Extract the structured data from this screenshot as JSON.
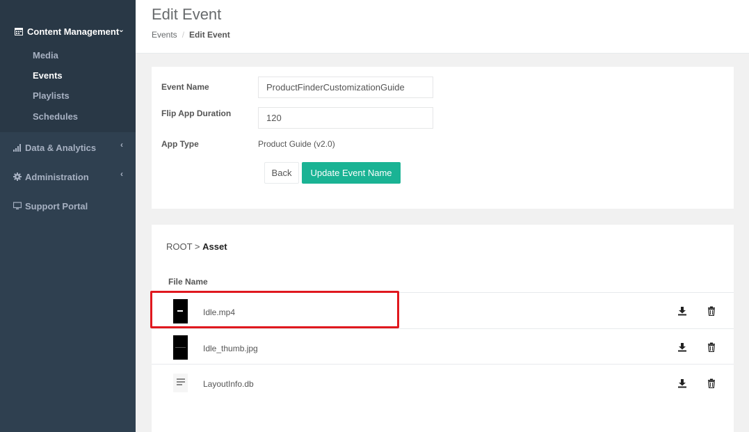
{
  "sidebar": {
    "section_title": "Content Management",
    "sub_items": [
      {
        "label": "Media",
        "active": false
      },
      {
        "label": "Events",
        "active": true
      },
      {
        "label": "Playlists",
        "active": false
      },
      {
        "label": "Schedules",
        "active": false
      }
    ],
    "items": [
      {
        "label": "Data & Analytics",
        "icon": "bar-chart-icon"
      },
      {
        "label": "Administration",
        "icon": "gear-icon"
      },
      {
        "label": "Support Portal",
        "icon": "monitor-icon"
      }
    ]
  },
  "header": {
    "title": "Edit Event",
    "breadcrumb": {
      "parent": "Events",
      "separator": "/",
      "current": "Edit Event"
    }
  },
  "form": {
    "event_name_label": "Event Name",
    "event_name_value": "ProductFinderCustomizationGuide",
    "duration_label": "Flip App Duration",
    "duration_value": "120",
    "app_type_label": "App Type",
    "app_type_value": "Product Guide (v2.0)",
    "back_label": "Back",
    "update_label": "Update Event Name"
  },
  "files": {
    "path_root": "ROOT >",
    "path_current": "Asset",
    "column_header": "File Name",
    "rows": [
      {
        "name": "Idle.mp4",
        "type": "video"
      },
      {
        "name": "Idle_thumb.jpg",
        "type": "image"
      },
      {
        "name": "LayoutInfo.db",
        "type": "document"
      }
    ]
  },
  "colors": {
    "sidebar_bg": "#2f4050",
    "accent": "#1ab394",
    "highlight": "#e0181e"
  }
}
